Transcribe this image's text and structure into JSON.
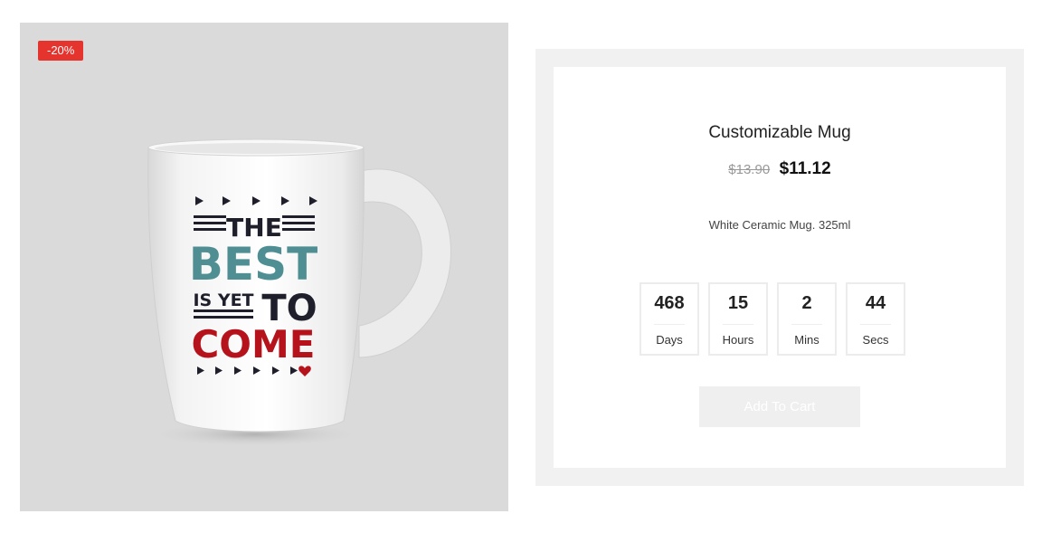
{
  "product": {
    "badge": "-20%",
    "title": "Customizable Mug",
    "old_price": "$13.90",
    "price": "$11.12",
    "description": "White Ceramic Mug. 325ml",
    "image": {
      "icon": "mug-photo",
      "print_lines": [
        "THE",
        "BEST",
        "IS YET",
        "TO",
        "COME"
      ]
    }
  },
  "countdown": [
    {
      "value": "468",
      "label": "Days"
    },
    {
      "value": "15",
      "label": "Hours"
    },
    {
      "value": "2",
      "label": "Mins"
    },
    {
      "value": "44",
      "label": "Secs"
    }
  ],
  "cart": {
    "label": "Add To Cart"
  },
  "colors": {
    "badge": "#e5332e",
    "teal_print": "#4f8f94",
    "red_print": "#b5121b",
    "dark_print": "#1e1f2b",
    "panel_bg": "#f1f1f1",
    "image_bg": "#dadada"
  }
}
